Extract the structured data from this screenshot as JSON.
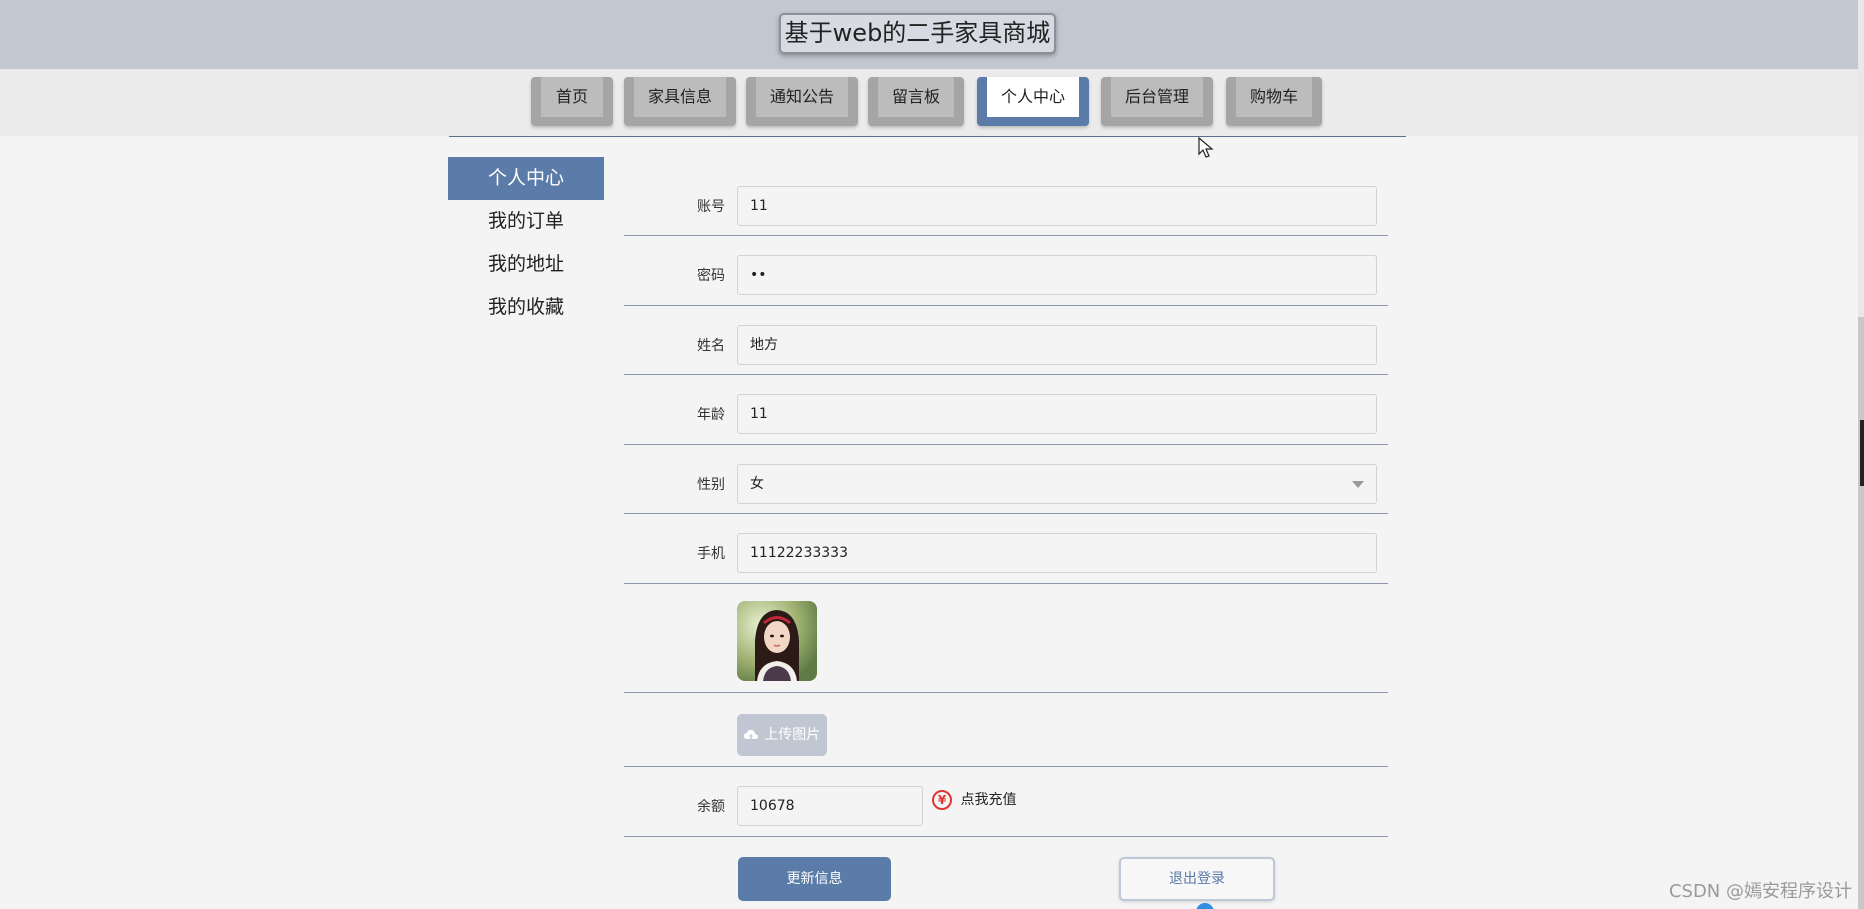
{
  "header": {
    "title": "基于web的二手家具商城"
  },
  "nav": {
    "items": [
      {
        "label": "首页",
        "active": false
      },
      {
        "label": "家具信息",
        "active": false
      },
      {
        "label": "通知公告",
        "active": false
      },
      {
        "label": "留言板",
        "active": false
      },
      {
        "label": "个人中心",
        "active": true
      },
      {
        "label": "后台管理",
        "active": false
      },
      {
        "label": "购物车",
        "active": false
      }
    ]
  },
  "sidebar": {
    "items": [
      {
        "label": "个人中心",
        "active": true
      },
      {
        "label": "我的订单",
        "active": false
      },
      {
        "label": "我的地址",
        "active": false
      },
      {
        "label": "我的收藏",
        "active": false
      }
    ]
  },
  "form": {
    "account": {
      "label": "账号",
      "value": "11"
    },
    "password": {
      "label": "密码",
      "value": "••"
    },
    "name": {
      "label": "姓名",
      "value": "地方"
    },
    "age": {
      "label": "年龄",
      "value": "11"
    },
    "gender": {
      "label": "性别",
      "value": "女"
    },
    "phone": {
      "label": "手机",
      "value": "11122233333"
    },
    "upload": {
      "label": "上传图片"
    },
    "balance": {
      "label": "余额",
      "value": "10678",
      "recharge_label": "点我充值",
      "recharge_icon": "yen-icon"
    }
  },
  "actions": {
    "update_label": "更新信息",
    "logout_label": "退出登录"
  },
  "watermark": "CSDN @嫣安程序设计",
  "colors": {
    "accent": "#5b7ba8",
    "header_bg": "#c2c7d1",
    "nav_bg": "#ebebeb",
    "page_bg": "#f4f4f4",
    "recharge_icon": "#e03535"
  }
}
